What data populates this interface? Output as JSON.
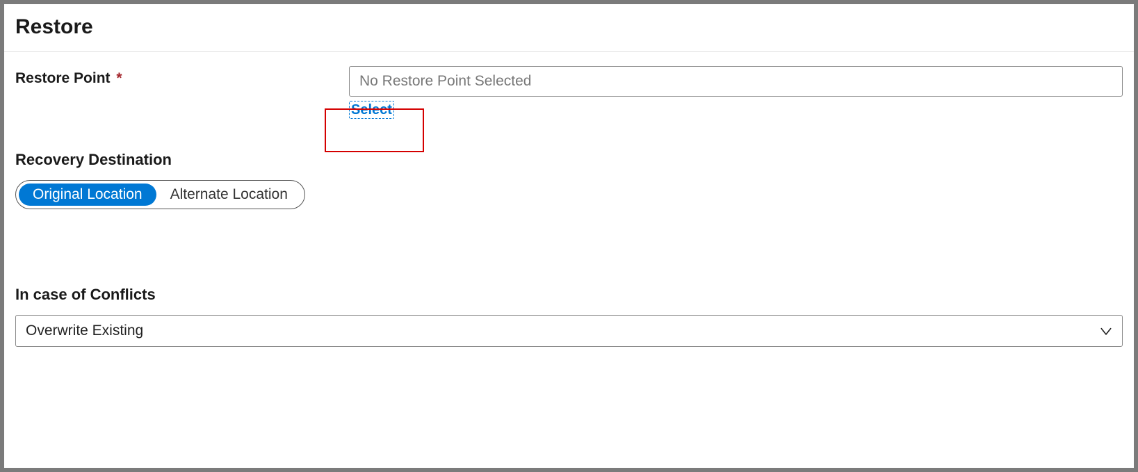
{
  "header": {
    "title": "Restore"
  },
  "restore_point": {
    "label": "Restore Point",
    "required_indicator": "*",
    "placeholder": "No Restore Point Selected",
    "select_link": "Select"
  },
  "recovery_destination": {
    "label": "Recovery Destination",
    "original": "Original Location",
    "alternate": "Alternate Location"
  },
  "conflicts": {
    "label": "In case of Conflicts",
    "selected": "Overwrite Existing"
  }
}
